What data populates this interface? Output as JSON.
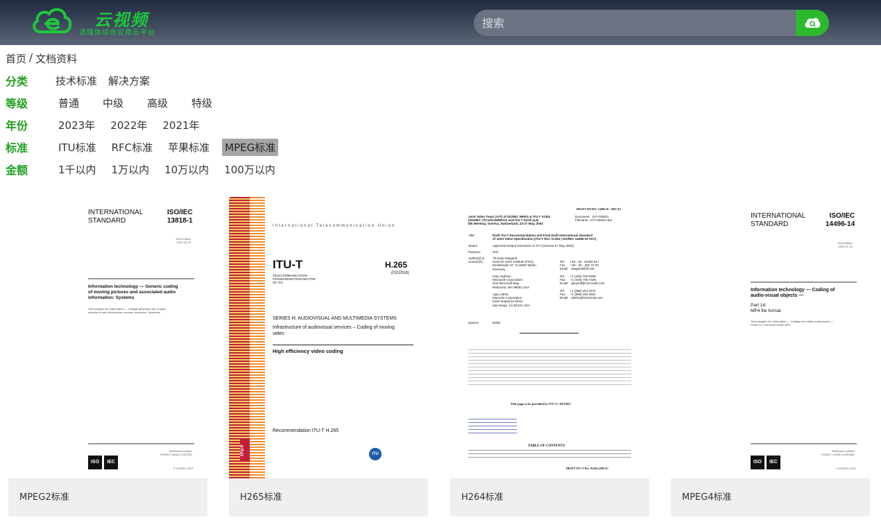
{
  "header": {
    "logo_title": "云视频",
    "logo_subtitle": "流媒体综合应用云平台",
    "search_placeholder": "搜索"
  },
  "breadcrumb": {
    "home": "首页",
    "separator": "/",
    "current": "文档资料"
  },
  "filters": [
    {
      "label": "分类",
      "options": [
        "技术标准",
        "解决方案"
      ]
    },
    {
      "label": "等级",
      "options": [
        "普通",
        "中级",
        "高级",
        "特级"
      ]
    },
    {
      "label": "年份",
      "options": [
        "2023年",
        "2022年",
        "2021年"
      ]
    },
    {
      "label": "标准",
      "options": [
        "ITU标准",
        "RFC标准",
        "苹果标准",
        "MPEG标准"
      ],
      "active": "MPEG标准"
    },
    {
      "label": "金额",
      "options": [
        "1千以内",
        "1万以内",
        "10万以内",
        "100万以内"
      ]
    }
  ],
  "cards": [
    {
      "caption": "MPEG2标准",
      "doc": {
        "org": "INTERNATIONAL\nSTANDARD",
        "code": "ISO/IEC\n13818-1",
        "edition": "Third edition\n2007-10-15",
        "title": "Information technology — Generic coding\nof moving pictures and associated audio\ninformation: Systems",
        "subtitle": "Technologies de l'information — Codage générique des images\nanimées et des informations sonores associées: Systèmes",
        "refnum": "Reference number\nISO/IEC 13818-1:2007(E)",
        "copyright": "© ISO/IEC 2007"
      }
    },
    {
      "caption": "H265标准",
      "doc": {
        "union": "International Telecommunication Union",
        "brand": "ITU-T",
        "code": "H.265",
        "date": "(02/2018)",
        "sector": "TELECOMMUNICATION\nSTANDARDIZATION SECTOR\nOF ITU",
        "series": "SERIES H: AUDIOVISUAL AND MULTIMEDIA SYSTEMS",
        "infra": "Infrastructure of audiovisual services – Coding of moving\nvideo",
        "title": "High efficiency video coding",
        "rec": "Recommendation  ITU-T  H.265",
        "side": "ITU-T"
      }
    },
    {
      "caption": "H264标准",
      "doc": {
        "draft": "DRAFT ISO/IEC 14496-10 : 2002 (E)",
        "team": "Joint Video Team (JVT) of ISO/IEC MPEG & ITU-T VCEG\n(ISO/IEC JTC1/SC29/WG11 and ITU-T SG16 Q.6)\n8th Meeting: Geneva, Switzerland, 23-27 May, 2003",
        "docinfo": "Document:  JVT-G050r1\nFilename: JVT-G050r1.doc",
        "title_label": "Title:",
        "title": "Draft ITU-T Recommendation and Final Draft International Standard\nof Joint Video Specification (ITU-T Rec. H.264 | ISO/IEC 14496-10 AVC)",
        "status": "Approved Output Document of JVT [Geneva 27 May 2003]",
        "purpose": "Text",
        "authors": "Thomas Wiegand\nHeinrich Hertz Institute (FhG),\nEinsteinufer 37, D-10587 Berlin,\nGermany\n\nGary Sullivan\nMicrosoft Corporation\nOne Microsoft Way\nRedmond, WA 98052 USA\n\nAjay Luthra\nMotorola Corporation\n6420 Sequence Drive\nSan Diego, CA 92121 USA",
        "contacts": "Tel:      +49 - 30 - 31002 617\nFax:     +49 - 30 - 392 72 00\nEmail:   wiegand@hhi.de\n\nTel:      +1 (425) 703-5308\nFax:     +1 (425) 706-7329\nEmail:   garysull@microsoft.com\n\nTel:      +1 (858) 404 3470\nFax:     +1 (858) 404 2501\nEmail:   aluthra@motorola.com",
        "source": "Editor",
        "title_page": "Title page to be provided by ITU-T | ISO/IEC",
        "toc": "TABLE OF CONTENTS",
        "footer": "DRAFT ITU-T Rec. H.264 (2002 E)"
      }
    },
    {
      "caption": "MPEG4标准",
      "doc": {
        "org": "INTERNATIONAL\nSTANDARD",
        "code": "ISO/IEC\n14496-14",
        "edition": "First edition\n2003-11-15",
        "title": "Information technology — Coding of\naudio-visual objects —",
        "part": "Part 14:\nMP4 file format",
        "subtitle": "Technologies de l'information — Codage des objets audiovisuels —\nPartie 14: Format de fichier MP4",
        "refnum": "Reference number\nISO/IEC 14496-14:2003(E)",
        "copyright": "© ISO/IEC 2003"
      }
    }
  ]
}
